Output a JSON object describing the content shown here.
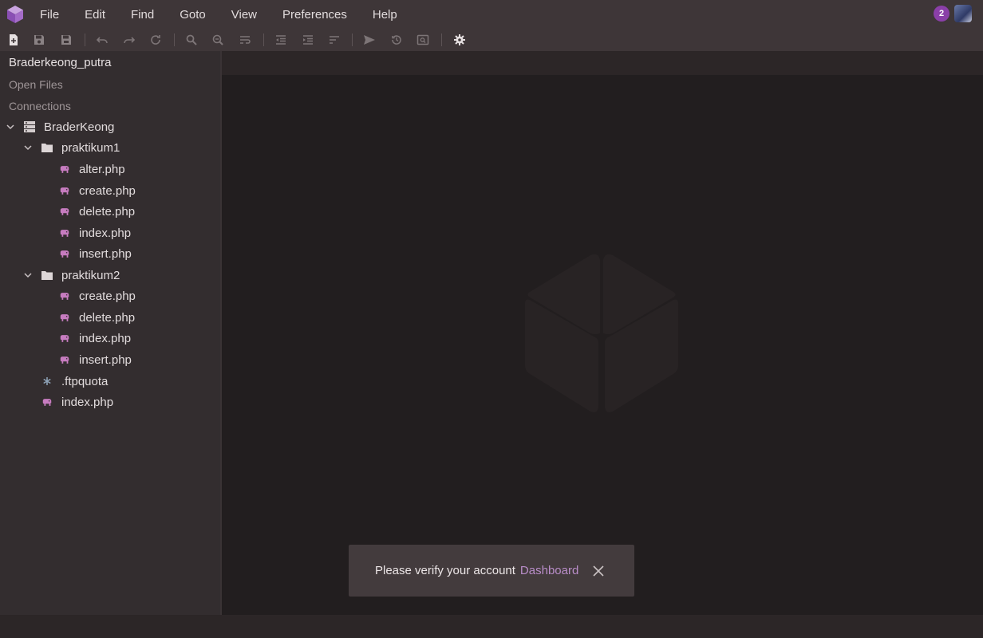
{
  "menu": [
    "File",
    "Edit",
    "Find",
    "Goto",
    "View",
    "Preferences",
    "Help"
  ],
  "notifications": {
    "count": "2"
  },
  "sidebar": {
    "title": "Braderkeong_putra",
    "open_files_label": "Open Files",
    "connections_label": "Connections",
    "tree": {
      "server": "BraderKeong",
      "folder1": {
        "name": "praktikum1",
        "files": [
          "alter.php",
          "create.php",
          "delete.php",
          "index.php",
          "insert.php"
        ]
      },
      "folder2": {
        "name": "praktikum2",
        "files": [
          "create.php",
          "delete.php",
          "index.php",
          "insert.php"
        ]
      },
      "root_files": [
        ".ftpquota",
        "index.php"
      ]
    }
  },
  "toast": {
    "message": "Please verify your account",
    "link": "Dashboard"
  },
  "colors": {
    "accent": "#8a3fa8",
    "php_icon": "#c77cc0",
    "link": "#b98dc9"
  }
}
